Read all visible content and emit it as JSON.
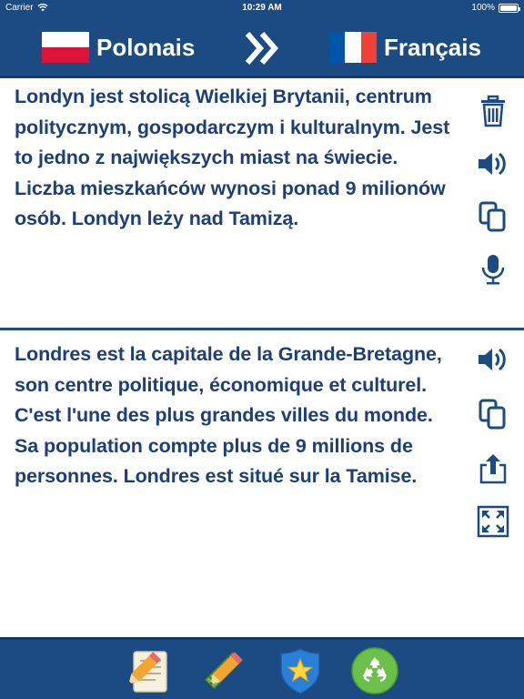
{
  "status_bar": {
    "carrier": "Carrier",
    "time": "10:29 AM",
    "battery": "100%"
  },
  "header": {
    "source_language": "Polonais",
    "target_language": "Français",
    "source_flag": "poland-flag",
    "target_flag": "france-flag",
    "swap_icon": "double-chevron-right-icon"
  },
  "source_panel": {
    "text": "Londyn jest stolicą Wielkiej Brytanii, centrum politycznym, gospodarczym i kulturalnym. Jest to jedno z największych miast na świecie. Liczba mieszkańców wynosi ponad 9 milionów osób. Londyn leży nad Tamizą.",
    "actions": [
      "trash-icon",
      "speaker-icon",
      "copy-icon",
      "microphone-icon"
    ]
  },
  "target_panel": {
    "text": "Londres est la capitale de la Grande-Bretagne, son centre politique, économique et culturel. C'est l'une des plus grandes villes du monde. Sa population compte plus de 9 millions de personnes. Londres est situé sur la Tamise.",
    "actions": [
      "speaker-icon",
      "copy-icon",
      "share-icon",
      "fullscreen-icon"
    ]
  },
  "bottom_tabs": [
    "notepad-icon",
    "pencil-ruler-icon",
    "star-shield-icon",
    "recycle-icon"
  ],
  "colors": {
    "brand_blue": "#1c4a82",
    "text_blue": "#1c3f7a",
    "background": "#ffffff"
  }
}
